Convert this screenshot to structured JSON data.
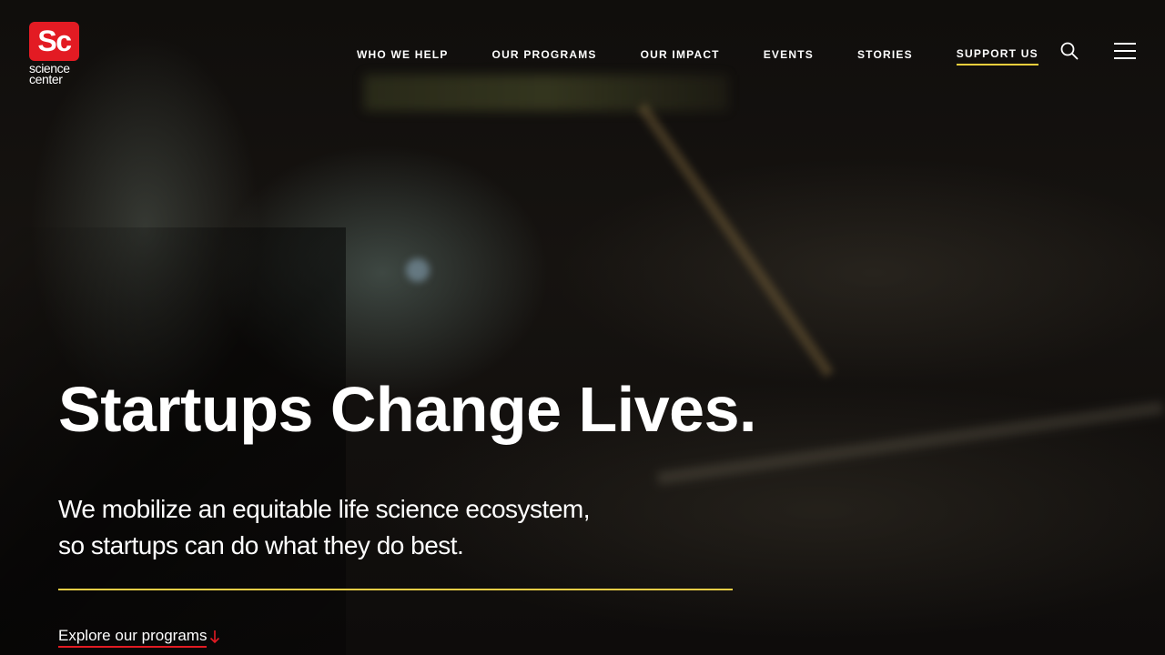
{
  "logo": {
    "mark": "Sc",
    "line1": "science",
    "line2": "center",
    "brand_color": "#e31b23"
  },
  "nav": {
    "items": [
      {
        "label": "WHO WE HELP",
        "active": false
      },
      {
        "label": "OUR PROGRAMS",
        "active": false
      },
      {
        "label": "OUR IMPACT",
        "active": false
      },
      {
        "label": "EVENTS",
        "active": false
      },
      {
        "label": "STORIES",
        "active": false
      },
      {
        "label": "SUPPORT US",
        "active": true
      }
    ],
    "active_underline_color": "#f2cf3c",
    "search_icon": "search-icon",
    "menu_icon": "hamburger-menu-icon"
  },
  "hero": {
    "title": "Startups Change Lives.",
    "subtitle_line1": "We mobilize an equitable life science ecosystem,",
    "subtitle_line2": "so startups can do what they do best.",
    "rule_color": "#e8cd46",
    "cta_label": "Explore our programs",
    "cta_icon": "arrow-down-icon",
    "cta_accent_color": "#e31b23"
  }
}
